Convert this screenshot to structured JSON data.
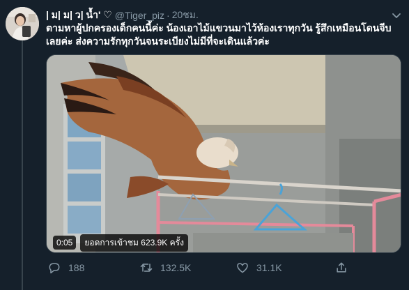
{
  "tweet": {
    "display_name": "| ม| ม| ว| น้ำ' ♡",
    "handle": "@Tiger_piz",
    "separator": "·",
    "time": "20ชม.",
    "text_line1": "ตามหาผู้ปกครองเด็กคนนี้ค่ะ น้องเอาไม้แขวนมาไว้ห้องเราทุกวัน รู้สึกเหมือนโดนจีบ",
    "text_line2": "เลยค่ะ ส่งความรักทุกวันจนระเบียงไม่มีที่จะเดินแล้วค่ะ"
  },
  "video": {
    "duration": "0:05",
    "views": "ยอดการเข้าชม 623.9K ครั้ง"
  },
  "actions": {
    "replies": "188",
    "retweets": "132.5K",
    "likes": "31.1K"
  },
  "icons": {
    "reply": "reply-icon",
    "retweet": "retweet-icon",
    "like": "heart-icon",
    "share": "share-icon",
    "more": "chevron-down-icon"
  },
  "colors": {
    "background": "#15202b",
    "secondary_text": "#8899a6",
    "border": "#38444d"
  }
}
